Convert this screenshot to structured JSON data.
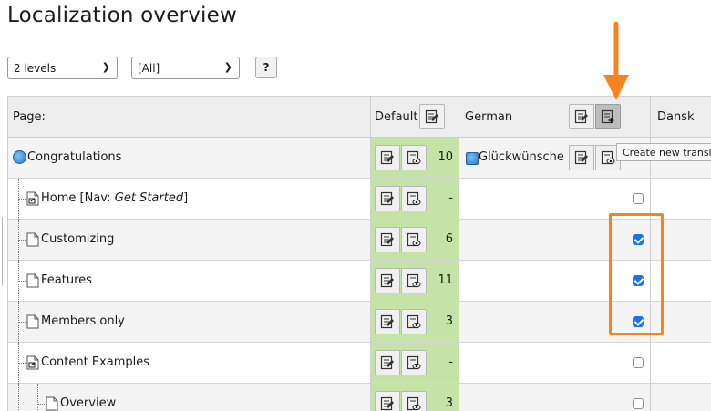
{
  "page": {
    "title": "Localization overview"
  },
  "controls": {
    "levels": {
      "value": "2 levels"
    },
    "language": {
      "value": "[All]"
    },
    "help_label": "?"
  },
  "table": {
    "headers": {
      "page": "Page:",
      "default": "Default:",
      "german": "German",
      "dansk": "Dansk"
    },
    "rows": [
      {
        "title": "Congratulations",
        "count": "10",
        "translation": "Glückwünsche"
      },
      {
        "title_prefix": "Home [Nav: ",
        "title_em": "Get Started",
        "title_suffix": "]",
        "count": "-",
        "checked": false
      },
      {
        "title": "Customizing",
        "count": "6",
        "checked": true
      },
      {
        "title": "Features",
        "count": "11",
        "checked": true
      },
      {
        "title": "Members only",
        "count": "3",
        "checked": true
      },
      {
        "title": "Content Examples",
        "count": "-",
        "checked": false
      },
      {
        "title": "Overview",
        "count": "3",
        "checked": false
      }
    ]
  },
  "tooltip": {
    "text": "Create new translation"
  },
  "colors": {
    "default_column_bg": "#c6e3a7",
    "highlight_orange": "#f5831f",
    "checkbox_blue": "#1a73e8"
  },
  "icons": {
    "edit": "edit-page-icon",
    "view": "view-page-icon",
    "new_translation": "new-translation-icon",
    "globe": "globe-icon",
    "page": "page-icon",
    "shortcut": "shortcut-page-icon"
  }
}
